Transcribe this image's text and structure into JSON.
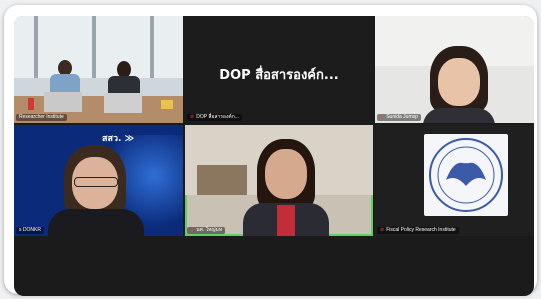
{
  "meeting": {
    "participants": [
      {
        "name": "Researcher Institute",
        "muted": false
      },
      {
        "name": "DOP สื่อสารองค์ก...",
        "muted": true,
        "camera_off": true,
        "display_text": "DOP สื่อสารองค์ก..."
      },
      {
        "name": "Sunida Jumsp",
        "muted": true
      },
      {
        "name": "s DONKR",
        "muted": false
      },
      {
        "name": "นศ. ใหญ่มห",
        "muted": true,
        "active_speaker": true
      },
      {
        "name": "Fiscal Policy Research Institute",
        "muted": true
      }
    ],
    "logo_text": "สสว."
  },
  "colors": {
    "active_speaker_border": "#5fd068",
    "muted_icon": "#e64545",
    "tile_blue": "#0b2a7a"
  },
  "icons": {
    "muted": "mic-off-icon"
  }
}
